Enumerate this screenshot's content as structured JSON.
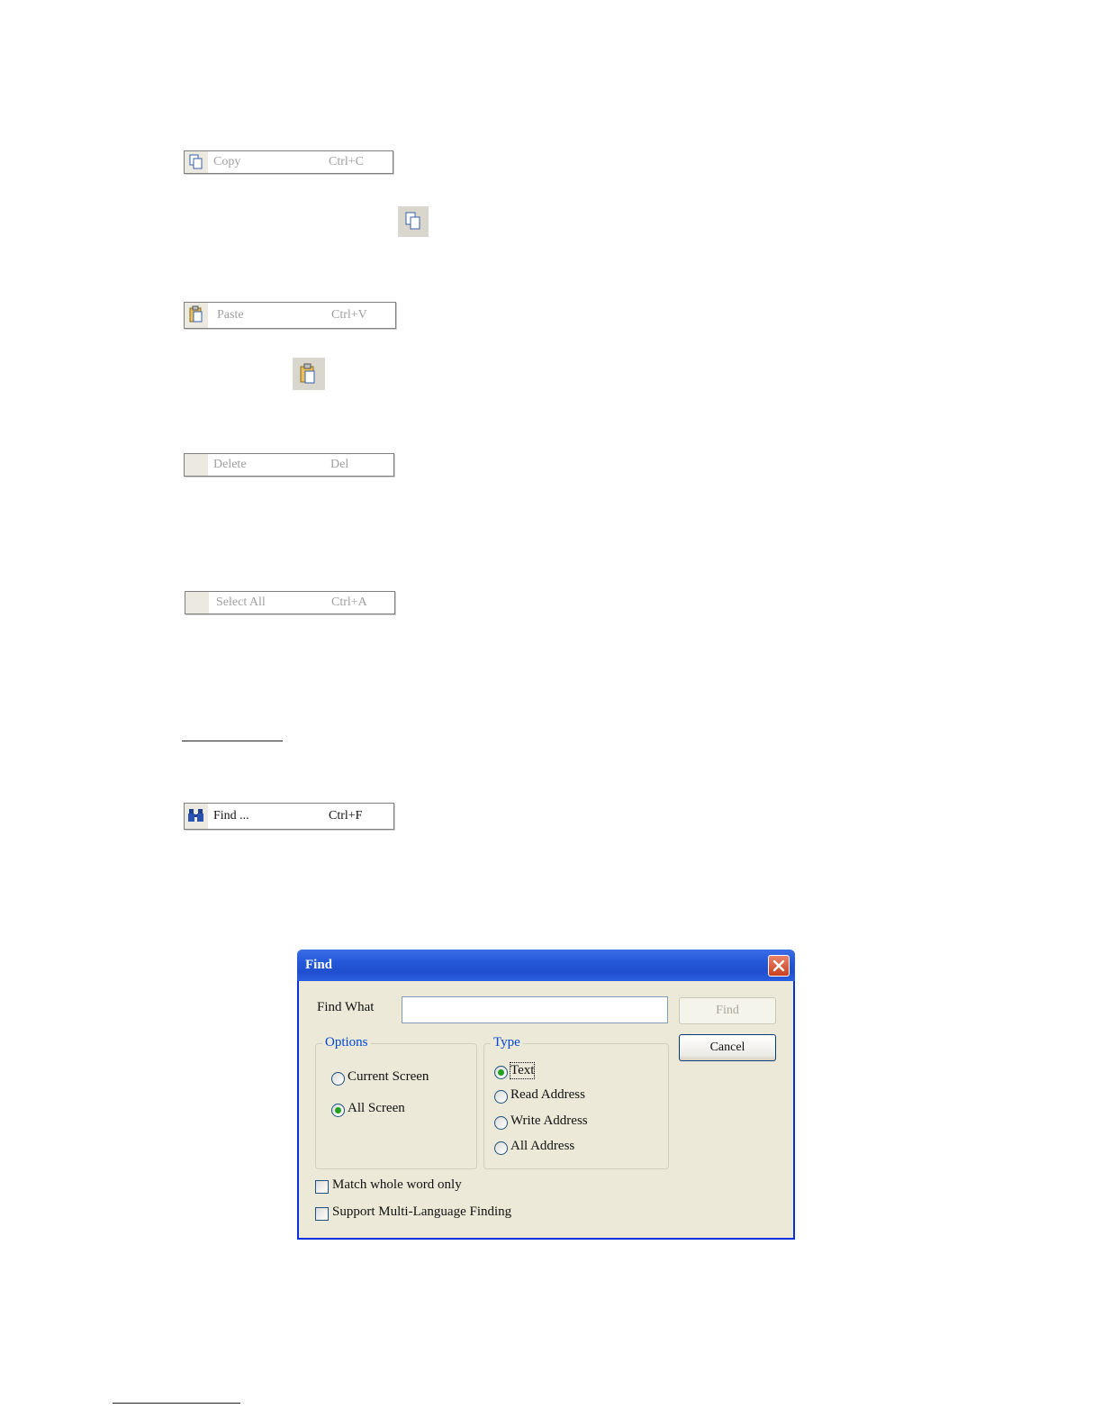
{
  "menu": {
    "copy": {
      "label": "Copy",
      "shortcut": "Ctrl+C"
    },
    "paste": {
      "label": "Paste",
      "shortcut": "Ctrl+V"
    },
    "delete": {
      "label": "Delete",
      "shortcut": "Del"
    },
    "select_all": {
      "label": "Select All",
      "shortcut": "Ctrl+A"
    },
    "find": {
      "label": "Find ...",
      "shortcut": "Ctrl+F"
    }
  },
  "dialog": {
    "title": "Find",
    "find_what_label": "Find What",
    "find_what_value": "",
    "find_button": "Find",
    "cancel_button": "Cancel",
    "options": {
      "legend": "Options",
      "items": [
        "Current Screen",
        "All Screen"
      ],
      "selected": "All Screen"
    },
    "type": {
      "legend": "Type",
      "items": [
        "Text",
        "Read Address",
        "Write Address",
        "All Address"
      ],
      "selected": "Text"
    },
    "checkboxes": [
      "Match whole word only",
      "Support Multi-Language Finding"
    ]
  },
  "colors": {
    "titlebar": "#2458d8",
    "dialog_bg": "#ece9d8",
    "legend": "#0046d5",
    "radio_dot": "#21a121"
  }
}
